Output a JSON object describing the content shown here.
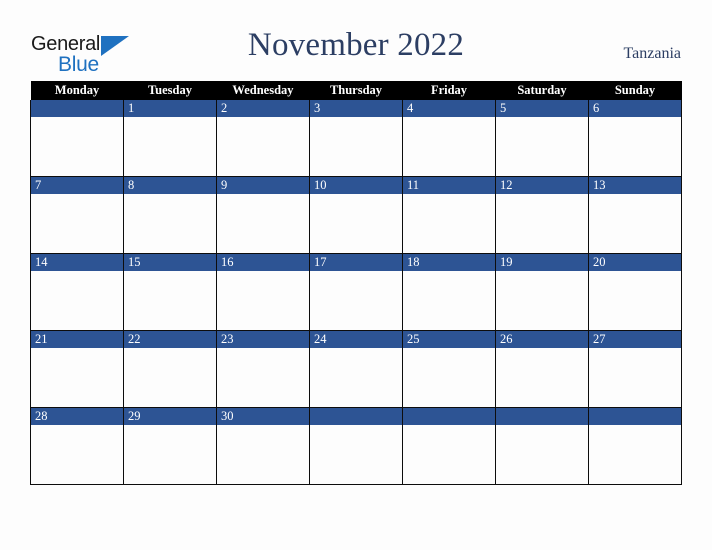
{
  "brand": {
    "word_one": "General",
    "word_two": "Blue",
    "triangle_color": "#1f71c0",
    "text_color": "#1a1a1a"
  },
  "header": {
    "title": "November 2022",
    "country": "Tanzania",
    "title_color": "#2c3e63"
  },
  "calendar": {
    "weekday_headers": [
      "Monday",
      "Tuesday",
      "Wednesday",
      "Thursday",
      "Friday",
      "Saturday",
      "Sunday"
    ],
    "header_bg": "#000000",
    "header_text": "#ffffff",
    "band_color": "#2d5494",
    "cell_bg": "#fdfdfd",
    "grid_color": "#0d0d0d",
    "weeks": [
      [
        "",
        "1",
        "2",
        "3",
        "4",
        "5",
        "6"
      ],
      [
        "7",
        "8",
        "9",
        "10",
        "11",
        "12",
        "13"
      ],
      [
        "14",
        "15",
        "16",
        "17",
        "18",
        "19",
        "20"
      ],
      [
        "21",
        "22",
        "23",
        "24",
        "25",
        "26",
        "27"
      ],
      [
        "28",
        "29",
        "30",
        "",
        "",
        "",
        ""
      ]
    ]
  }
}
